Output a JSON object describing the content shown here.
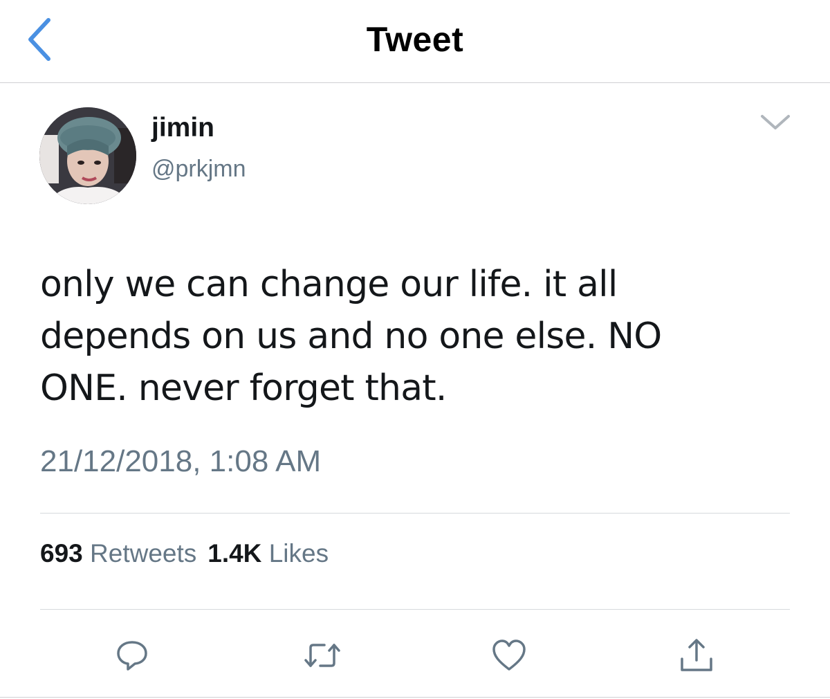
{
  "header": {
    "title": "Tweet",
    "back_icon": "chevron-left-icon",
    "accent_color": "#4a90e2"
  },
  "author": {
    "display_name": "jimin",
    "handle": "@prkjmn",
    "avatar": "profile-photo",
    "menu_icon": "chevron-down-icon"
  },
  "tweet": {
    "text": "only we can change our life. it all depends on us and no one else. NO ONE. never forget that.",
    "timestamp": "21/12/2018, 1:08 AM"
  },
  "stats": {
    "retweets_count": "693",
    "retweets_label": "Retweets",
    "likes_count": "1.4K",
    "likes_label": "Likes"
  },
  "actions": [
    {
      "name": "reply",
      "icon": "comment-icon"
    },
    {
      "name": "retweet",
      "icon": "retweet-icon"
    },
    {
      "name": "like",
      "icon": "heart-icon"
    },
    {
      "name": "share",
      "icon": "share-icon"
    }
  ],
  "colors": {
    "text_primary": "#14171a",
    "text_secondary": "#657786",
    "divider": "#d6d9dc"
  }
}
